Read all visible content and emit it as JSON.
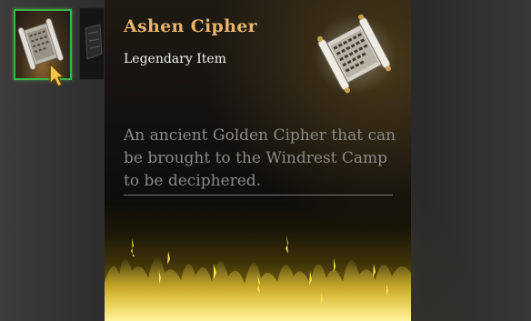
{
  "tooltip": {
    "title": "Ashen Cipher",
    "rarity": "Legendary Item",
    "description": "An ancient Golden Cipher that can be brought to the Windrest Camp to be deciphered."
  },
  "inventory": {
    "selected_slot_icon": "scroll-cipher-icon",
    "second_slot_icon": "dark-item-icon"
  },
  "colors": {
    "title": "#e8b469",
    "rarity": "#f2f2f2",
    "description": "#8c8a86",
    "selection_border": "#3fb24a",
    "fire_gold": "#ffd93a"
  }
}
